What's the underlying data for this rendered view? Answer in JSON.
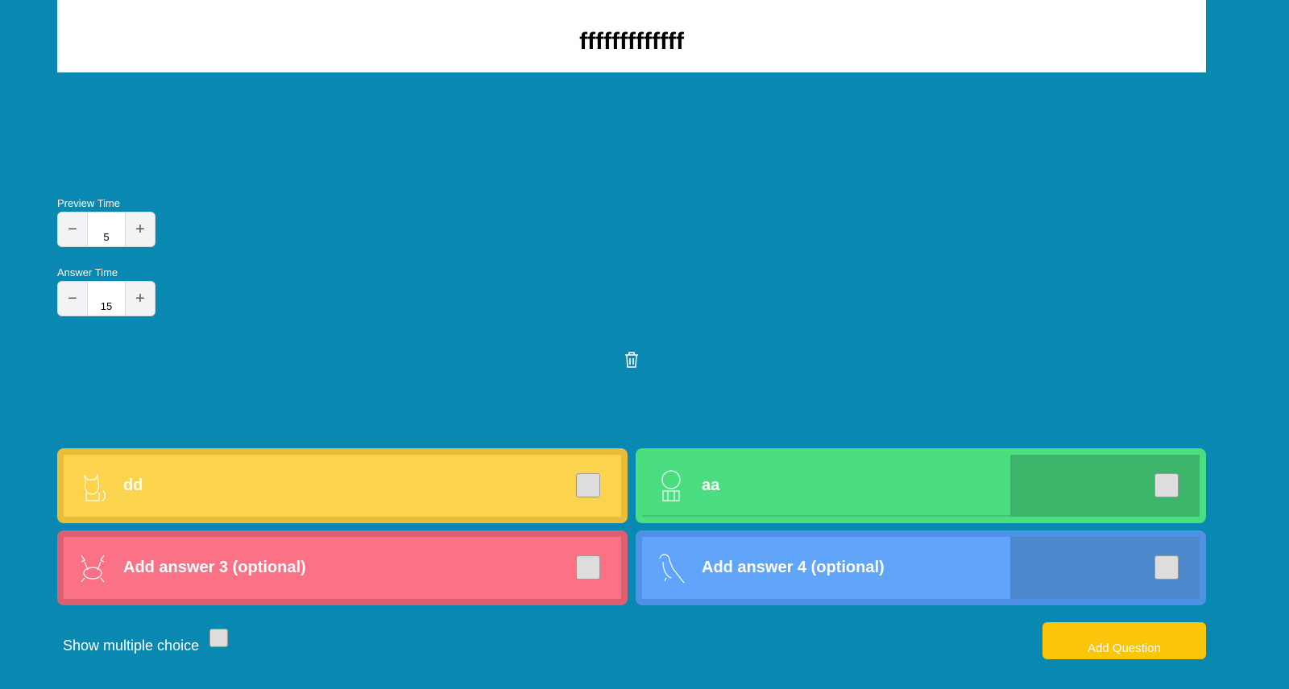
{
  "header": {
    "title": "fffffffffffff"
  },
  "preview_time": {
    "label": "Preview Time",
    "value": "5",
    "minus": "−",
    "plus": "+"
  },
  "answer_time": {
    "label": "Answer Time",
    "value": "15",
    "minus": "−",
    "plus": "+"
  },
  "answers": [
    {
      "text": "dd",
      "icon": "cat-icon",
      "color": "#fbd34d",
      "border": "#e9bd38"
    },
    {
      "text": "aa",
      "icon": "frog-icon",
      "color": "#4ade80",
      "border": "#3cc56f"
    },
    {
      "text": "Add answer 3 (optional)",
      "icon": "crab-icon",
      "color": "#fb7185",
      "border": "#dd5f72"
    },
    {
      "text": "Add answer 4 (optional)",
      "icon": "parrot-icon",
      "color": "#60a5fa",
      "border": "#4f91e4"
    }
  ],
  "footer": {
    "multiple_choice_label": "Show multiple choice",
    "add_question": "Add Question"
  }
}
